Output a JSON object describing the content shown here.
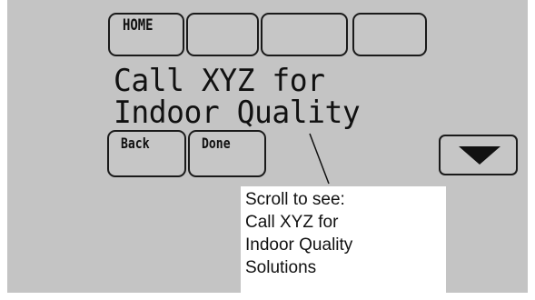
{
  "top_buttons": [
    {
      "label": "HOME"
    },
    {
      "label": ""
    },
    {
      "label": ""
    },
    {
      "label": ""
    }
  ],
  "message": {
    "line1": "Call XYZ for",
    "line2": "Indoor Quality"
  },
  "bottom_buttons": {
    "back_label": "Back",
    "done_label": "Done"
  },
  "arrow_button": {
    "icon": "down-arrow-icon"
  },
  "callout": {
    "lines": [
      "Scroll to see:",
      "Call XYZ for",
      "Indoor Quality",
      "Solutions"
    ]
  }
}
